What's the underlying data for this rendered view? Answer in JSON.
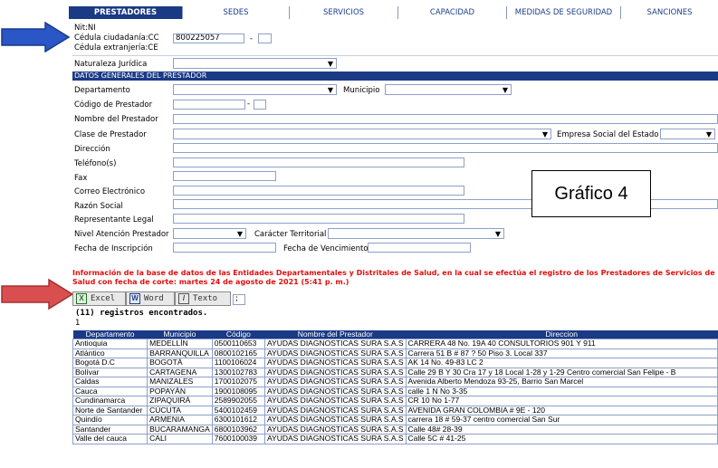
{
  "tabs": [
    "PRESTADORES",
    "SEDES",
    "SERVICIOS",
    "CAPACIDAD",
    "MEDIDAS DE SEGURIDAD",
    "SANCIONES"
  ],
  "id": {
    "nit": "Nit:NI",
    "cc": "Cédula ciudadanía:CC",
    "ce": "Cédula extranjería:CE",
    "value": "800225057",
    "dash": "-"
  },
  "labels": {
    "naturaleza": "Naturaleza Jurídica",
    "section": "DATOS GENERALES DEL PRESTADOR",
    "departamento": "Departamento",
    "municipio": "Municipio",
    "codigo": "Código de Prestador",
    "nombre": "Nombre del Prestador",
    "clase": "Clase de Prestador",
    "ese": "Empresa Social del Estado",
    "direccion": "Dirección",
    "telefono": "Teléfono(s)",
    "fax": "Fax",
    "correo": "Correo Electrónico",
    "razon": "Razón Social",
    "representante": "Representante Legal",
    "nivel": "Nivel Atención Prestador",
    "caracter": "Carácter Territorial",
    "inscripcion": "Fecha de Inscripción",
    "vencimiento": "Fecha de Vencimiento"
  },
  "callout": "Gráfico 4",
  "warning": "Información de la base de datos de las Entidades Departamentales y Distritales de Salud, en la cual se efectúa el registro de los Prestadores de Servicios de Salud con fecha de corte: martes 24 de agosto de 2021 (5:41 p. m.)",
  "exports": [
    {
      "label": "Excel",
      "icon": "X",
      "color": "#1d7a1d"
    },
    {
      "label": "Word",
      "icon": "W",
      "color": "#1d3f9a"
    },
    {
      "label": "Texto",
      "icon": "/",
      "color": "#333"
    }
  ],
  "export_sep": ";",
  "count": "(11) registros encontrados.",
  "page": "1",
  "table": {
    "headers": [
      "Departamento",
      "Municipio",
      "Código",
      "Nombre del Prestador",
      "Direccion"
    ],
    "rows": [
      [
        "Antioquia",
        "MEDELLÍN",
        "0500110653",
        "AYUDAS DIAGNOSTICAS SURA S.A.S",
        "CARRERA 48 No. 19A 40 CONSULTORIOS 901 Y 911"
      ],
      [
        "Atlántico",
        "BARRANQUILLA",
        "0800102165",
        "AYUDAS DIAGNOSTICAS SURA S.A.S",
        "Carrera 51 B # 87 ? 50 Piso 3. Local 337"
      ],
      [
        "Bogotá D.C",
        "BOGOTÁ",
        "1100106024",
        "AYUDAS DIAGNOSTICAS SURA S.A.S",
        "AK 14 No. 49-83 LC 2"
      ],
      [
        "Bolívar",
        "CARTAGENA",
        "1300102783",
        "AYUDAS DIAGNOSTICAS SURA S.A.S",
        "Calle 29 B Y 30 Cra 17 y 18 Local 1-28 y 1-29 Centro comercial San Felipe - B"
      ],
      [
        "Caldas",
        "MANIZALES",
        "1700102075",
        "AYUDAS DIAGNOSTICAS SURA S.A.S",
        "Avenida Alberto Mendoza 93-25, Barrio San Marcel"
      ],
      [
        "Cauca",
        "POPAYÁN",
        "1900108095",
        "AYUDAS DIAGNOSTICAS SURA S.A.S",
        "calle 1 N No 3-35"
      ],
      [
        "Cundinamarca",
        "ZIPAQUIRÁ",
        "2589902055",
        "AYUDAS DIAGNOSTICAS SURA S.A.S",
        "CR 10 No 1-77"
      ],
      [
        "Norte de Santander",
        "CÚCUTA",
        "5400102459",
        "AYUDAS DIAGNOSTICAS SURA S.A.S",
        "AVENIDA GRAN COLOMBIA # 9E - 120"
      ],
      [
        "Quindío",
        "ARMENIA",
        "6300101612",
        "AYUDAS DIAGNOSTICAS SURA S.A.S",
        "carrera 18 # 59-37 centro comercial San Sur"
      ],
      [
        "Santander",
        "BUCARAMANGA",
        "6800103962",
        "AYUDAS DIAGNOSTICAS SURA S.A.S",
        "Calle 48# 28-39"
      ],
      [
        "Valle del cauca",
        "CALI",
        "7600100039",
        "AYUDAS DIAGNOSTICAS SURA S.A.S",
        "Calle 5C # 41-25"
      ]
    ]
  }
}
